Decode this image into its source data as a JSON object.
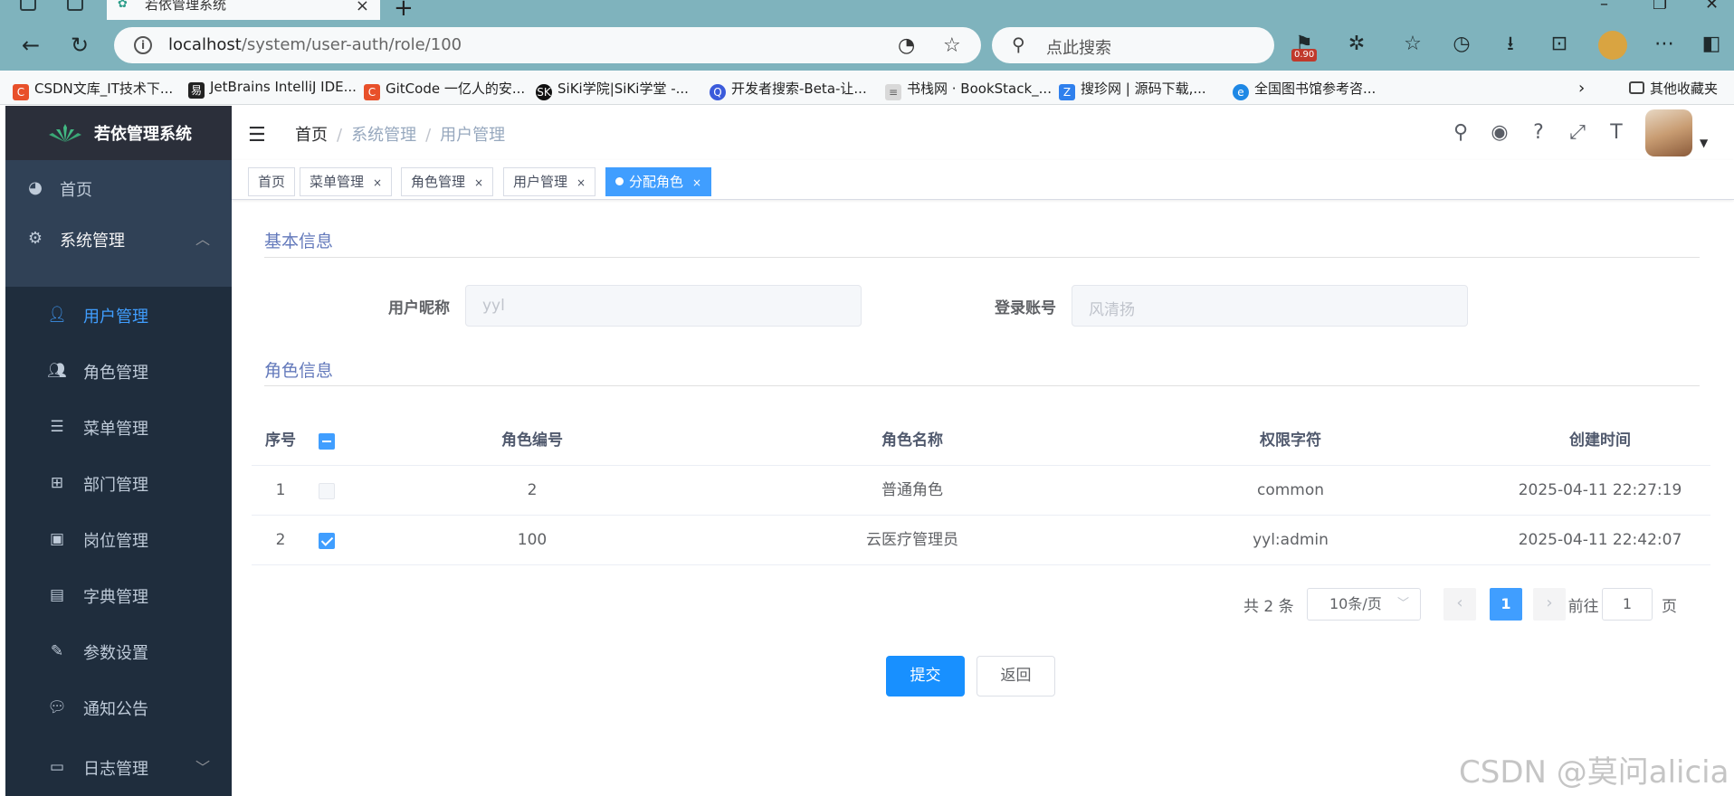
{
  "browser": {
    "tab_title": "若依管理系统",
    "url_host": "localhost",
    "url_path": "/system/user-auth/role/100",
    "search_placeholder": "点此搜索",
    "badge": "0.90",
    "bookmarks": [
      {
        "label": "CSDN文库_IT技术下...",
        "color": "#e8502a",
        "glyph": "C"
      },
      {
        "label": "JetBrains IntelliJ IDE...",
        "color": "#222222",
        "glyph": "易"
      },
      {
        "label": "GitCode 一亿人的安...",
        "color": "#e8502a",
        "glyph": "C"
      },
      {
        "label": "SiKi学院|SiKi学堂 -...",
        "color": "#111111",
        "glyph": "SK"
      },
      {
        "label": "开发者搜索-Beta-让...",
        "color": "#3b5bdb",
        "glyph": "Q"
      },
      {
        "label": "书栈网 · BookStack_...",
        "color": "#d9d9d9",
        "glyph": "≡"
      },
      {
        "label": "搜珍网 | 源码下载,...",
        "color": "#2f80ed",
        "glyph": "Z"
      },
      {
        "label": "全国图书馆参考咨...",
        "color": "#1e88e5",
        "glyph": "e"
      }
    ],
    "other_bookmarks": "其他收藏夹"
  },
  "sidebar": {
    "logo_title": "若依管理系统",
    "home": "首页",
    "system": "系统管理",
    "sub_items": [
      {
        "label": "用户管理",
        "icon": "user-icon"
      },
      {
        "label": "角色管理",
        "icon": "peoples-icon"
      },
      {
        "label": "菜单管理",
        "icon": "tree-table-icon"
      },
      {
        "label": "部门管理",
        "icon": "tree-icon"
      },
      {
        "label": "岗位管理",
        "icon": "post-icon"
      },
      {
        "label": "字典管理",
        "icon": "dict-icon"
      },
      {
        "label": "参数设置",
        "icon": "edit-icon"
      },
      {
        "label": "通知公告",
        "icon": "message-icon"
      },
      {
        "label": "日志管理",
        "icon": "log-icon"
      }
    ]
  },
  "header": {
    "breadcrumb": [
      "首页",
      "系统管理",
      "用户管理"
    ]
  },
  "tags": [
    {
      "label": "首页",
      "closable": false
    },
    {
      "label": "菜单管理",
      "closable": true
    },
    {
      "label": "角色管理",
      "closable": true
    },
    {
      "label": "用户管理",
      "closable": true
    },
    {
      "label": "分配角色",
      "closable": true,
      "active": true
    }
  ],
  "basic_info": {
    "title": "基本信息",
    "nickname_label": "用户昵称",
    "nickname_value": "yyl",
    "account_label": "登录账号",
    "account_value": "风清扬"
  },
  "role_info": {
    "title": "角色信息",
    "columns": [
      "序号",
      "角色编号",
      "角色名称",
      "权限字符",
      "创建时间"
    ],
    "rows": [
      {
        "index": "1",
        "role_id": "2",
        "role_name": "普通角色",
        "role_key": "common",
        "created": "2025-04-11 22:27:19",
        "checked": false
      },
      {
        "index": "2",
        "role_id": "100",
        "role_name": "云医疗管理员",
        "role_key": "yyl:admin",
        "created": "2025-04-11 22:42:07",
        "checked": true
      }
    ]
  },
  "pagination": {
    "total": "共 2 条",
    "page_size": "10条/页",
    "current_page": "1",
    "goto_label": "前往",
    "goto_value": "1",
    "page_suffix": "页"
  },
  "actions": {
    "submit": "提交",
    "back": "返回"
  },
  "watermark": "CSDN @莫问alicia"
}
